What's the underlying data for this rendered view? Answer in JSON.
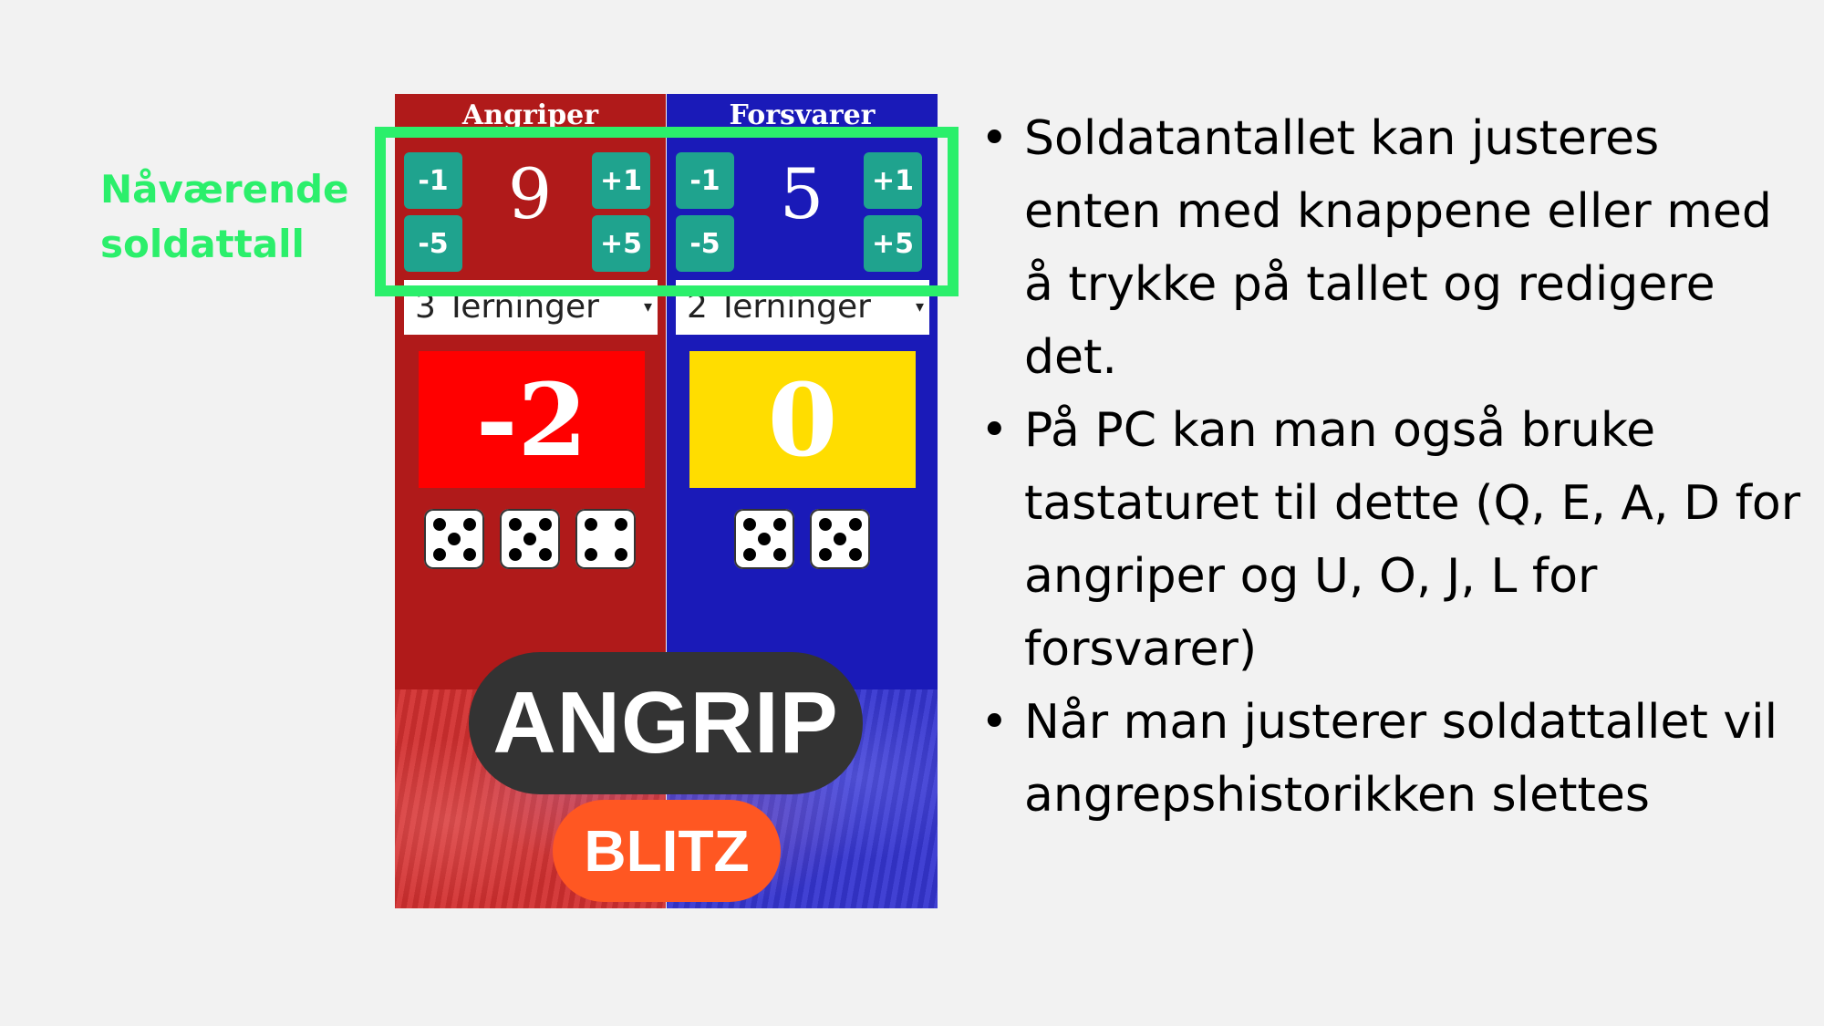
{
  "annotation": {
    "label_line1": "Nåværende",
    "label_line2": "soldattall",
    "color": "#2bef6b"
  },
  "attacker": {
    "title": "Angriper",
    "minus1": "-1",
    "minus5": "-5",
    "plus1": "+1",
    "plus5": "+5",
    "count": "9",
    "dice_select": "3 Terninger",
    "result": "-2",
    "dice_faces": [
      5,
      5,
      4
    ],
    "color": "#b01a1a"
  },
  "defender": {
    "title": "Forsvarer",
    "minus1": "-1",
    "minus5": "-5",
    "plus1": "+1",
    "plus5": "+5",
    "count": "5",
    "dice_select": "2 Terninger",
    "result": "0",
    "dice_faces": [
      5,
      5
    ],
    "color": "#1a1ab8"
  },
  "buttons": {
    "attack": "ANGRIP",
    "blitz": "BLITZ"
  },
  "bullets": [
    "Soldatantallet kan justeres enten med knappene eller med å trykke på tallet og redigere det.",
    "På PC kan man også bruke tastaturet til dette (Q, E, A, D for angriper og U, O, J, L for forsvarer)",
    "Når man justerer soldattallet vil angrepshistorikken slettes"
  ]
}
